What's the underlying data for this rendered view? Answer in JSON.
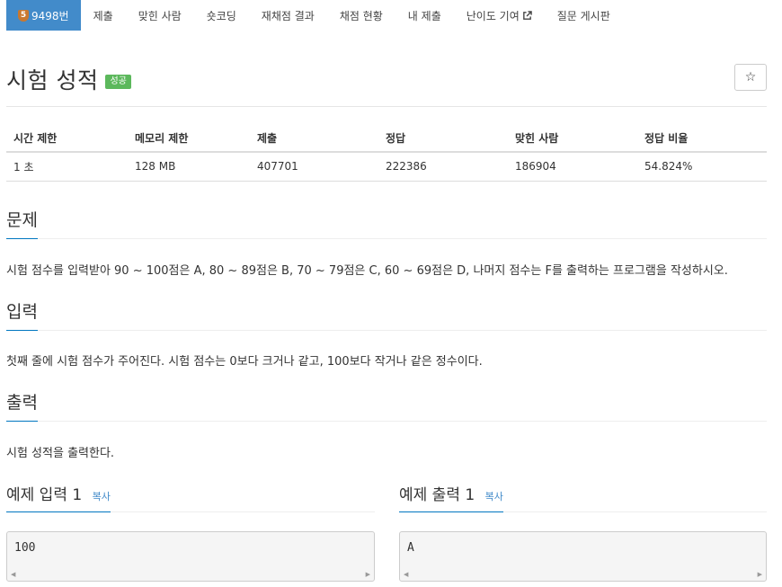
{
  "tabs": [
    {
      "tier": "5",
      "label": "9498번",
      "active": true
    },
    {
      "label": "제출"
    },
    {
      "label": "맞힌 사람"
    },
    {
      "label": "숏코딩"
    },
    {
      "label": "재채점 결과"
    },
    {
      "label": "채점 현황"
    },
    {
      "label": "내 제출"
    },
    {
      "label": "난이도 기여"
    },
    {
      "label": "질문 게시판"
    }
  ],
  "problem": {
    "title": "시험 성적",
    "status_label": "성공",
    "star_glyph": "☆"
  },
  "info_table": {
    "headers": [
      "시간 제한",
      "메모리 제한",
      "제출",
      "정답",
      "맞힌 사람",
      "정답 비율"
    ],
    "values": [
      "1 초",
      "128 MB",
      "407701",
      "222386",
      "186904",
      "54.824%"
    ]
  },
  "sections": {
    "description": {
      "title": "문제",
      "text": "시험 점수를 입력받아 90 ~ 100점은 A, 80 ~ 89점은 B, 70 ~ 79점은 C, 60 ~ 69점은 D, 나머지 점수는 F를 출력하는 프로그램을 작성하시오."
    },
    "input": {
      "title": "입력",
      "text": "첫째 줄에 시험 점수가 주어진다. 시험 점수는 0보다 크거나 같고, 100보다 작거나 같은 정수이다."
    },
    "output": {
      "title": "출력",
      "text": "시험 성적을 출력한다."
    }
  },
  "samples": {
    "input": {
      "title": "예제 입력 1",
      "copy_label": "복사",
      "content": "100"
    },
    "output": {
      "title": "예제 출력 1",
      "copy_label": "복사",
      "content": "A"
    }
  },
  "colors": {
    "tab_active": "#428bca",
    "success": "#5cb85c",
    "link": "#428bca",
    "section_underline": "#0076c0"
  }
}
